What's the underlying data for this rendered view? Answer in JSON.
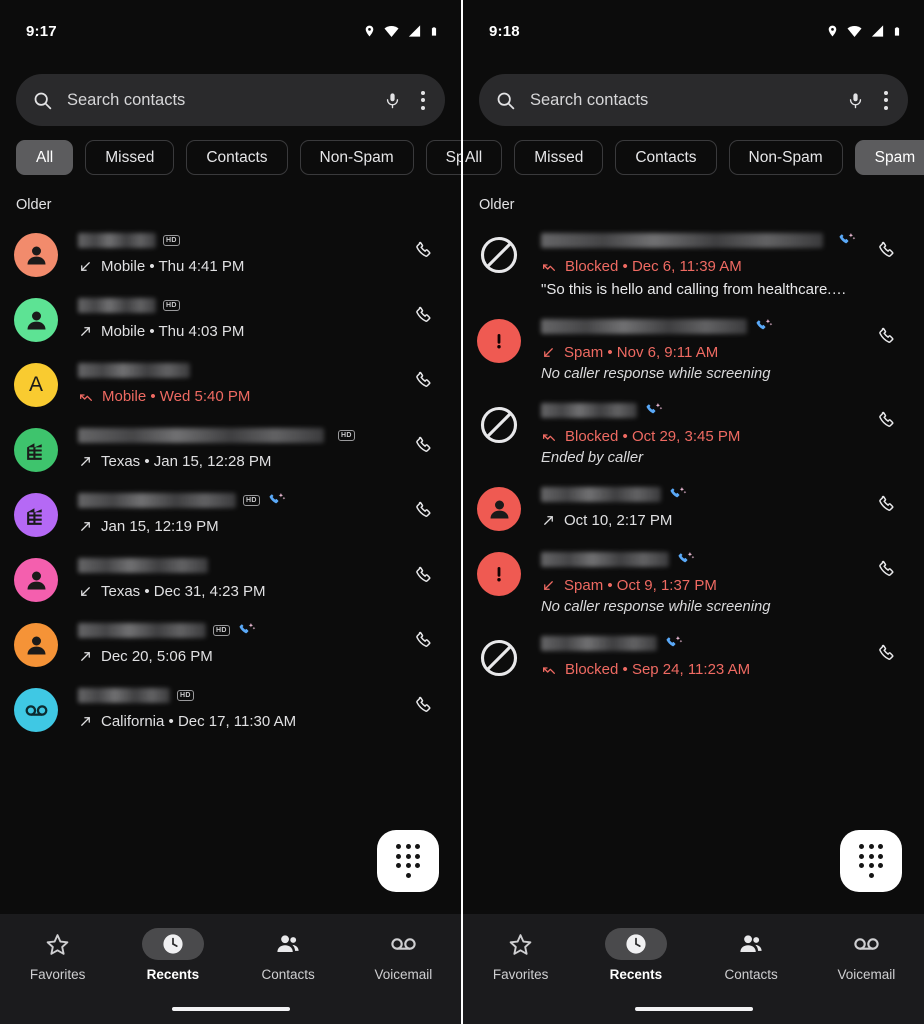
{
  "theme": {
    "background": "#0c0c0c",
    "nav_background": "#1b1b1d",
    "search_background": "#2a2a2c",
    "accent_red": "#ef6a62",
    "chip_selected": "#5c5c5e",
    "fab_background": "#ffffff",
    "divider": "#ffffff"
  },
  "panels": [
    {
      "id": "recents-all",
      "status_bar": {
        "time": "9:17",
        "icons": [
          "location-icon",
          "wifi-icon",
          "signal-icon",
          "battery-icon"
        ]
      },
      "search": {
        "placeholder": "Search contacts",
        "search_icon": "search-icon",
        "mic_icon": "microphone-icon",
        "overflow_icon": "more-vert-icon"
      },
      "chips": [
        {
          "label": "All",
          "selected": true
        },
        {
          "label": "Missed",
          "selected": false
        },
        {
          "label": "Contacts",
          "selected": false
        },
        {
          "label": "Non-Spam",
          "selected": false
        },
        {
          "label": "Spam",
          "selected": false
        }
      ],
      "chips_scrolled": false,
      "section_label": "Older",
      "calls": [
        {
          "avatar": {
            "type": "person",
            "color": "#f28b6c",
            "letter": ""
          },
          "name_redacted": true,
          "name_width": 78,
          "hd": true,
          "screened": false,
          "direction": "incoming",
          "detail": "Mobile • Thu 4:41 PM",
          "red": false,
          "note": "",
          "transcript": ""
        },
        {
          "avatar": {
            "type": "person",
            "color": "#5de394",
            "letter": ""
          },
          "name_redacted": true,
          "name_width": 78,
          "hd": true,
          "screened": false,
          "direction": "outgoing",
          "detail": "Mobile • Thu 4:03 PM",
          "red": false,
          "note": "",
          "transcript": ""
        },
        {
          "avatar": {
            "type": "letter",
            "color": "#f9cb30",
            "letter": "A"
          },
          "name_redacted": true,
          "name_width": 112,
          "hd": false,
          "screened": false,
          "direction": "missed",
          "detail": "Mobile • Wed 5:40 PM",
          "red": true,
          "note": "",
          "transcript": ""
        },
        {
          "avatar": {
            "type": "business",
            "color": "#3ec46d",
            "letter": ""
          },
          "name_redacted": true,
          "name_width": 246,
          "hd": true,
          "screened": false,
          "direction": "outgoing",
          "detail": "Texas • Jan 15, 12:28 PM",
          "red": false,
          "note": "",
          "transcript": ""
        },
        {
          "avatar": {
            "type": "business",
            "color": "#b569f5",
            "letter": ""
          },
          "name_redacted": true,
          "name_width": 158,
          "hd": true,
          "screened": true,
          "direction": "outgoing",
          "detail": "Jan 15, 12:19 PM",
          "red": false,
          "note": "",
          "transcript": ""
        },
        {
          "avatar": {
            "type": "person",
            "color": "#f45fae",
            "letter": ""
          },
          "name_redacted": true,
          "name_width": 130,
          "hd": false,
          "screened": false,
          "direction": "incoming",
          "detail": "Texas • Dec 31, 4:23 PM",
          "red": false,
          "note": "",
          "transcript": ""
        },
        {
          "avatar": {
            "type": "person",
            "color": "#f59337",
            "letter": ""
          },
          "name_redacted": true,
          "name_width": 128,
          "hd": true,
          "screened": true,
          "direction": "outgoing",
          "detail": "Dec 20, 5:06 PM",
          "red": false,
          "note": "",
          "transcript": ""
        },
        {
          "avatar": {
            "type": "voicemail",
            "color": "#3fc8e4",
            "letter": ""
          },
          "name_redacted": true,
          "name_width": 92,
          "hd": true,
          "screened": false,
          "direction": "outgoing",
          "detail": "California • Dec 17, 11:30 AM",
          "red": false,
          "note": "",
          "transcript": ""
        }
      ]
    },
    {
      "id": "recents-spam",
      "status_bar": {
        "time": "9:18",
        "icons": [
          "location-icon",
          "wifi-icon",
          "signal-icon",
          "battery-icon"
        ]
      },
      "search": {
        "placeholder": "Search contacts",
        "search_icon": "search-icon",
        "mic_icon": "microphone-icon",
        "overflow_icon": "more-vert-icon"
      },
      "chips": [
        {
          "label": "All",
          "selected": false
        },
        {
          "label": "Missed",
          "selected": false
        },
        {
          "label": "Contacts",
          "selected": false
        },
        {
          "label": "Non-Spam",
          "selected": false
        },
        {
          "label": "Spam",
          "selected": true
        }
      ],
      "chips_scrolled": true,
      "section_label": "Older",
      "calls": [
        {
          "avatar": {
            "type": "blocked",
            "color": "#e8e8ea",
            "letter": ""
          },
          "name_redacted": true,
          "name_width": 290,
          "hd": false,
          "screened": true,
          "direction": "missed",
          "detail": "Blocked • Dec 6, 11:39 AM",
          "red": true,
          "note": "",
          "transcript": "\"So this is hello and calling from healthcare.…"
        },
        {
          "avatar": {
            "type": "alert",
            "color": "#ef5a52",
            "letter": ""
          },
          "name_redacted": true,
          "name_width": 206,
          "hd": false,
          "screened": true,
          "direction": "incoming",
          "detail": "Spam • Nov 6, 9:11 AM",
          "red": true,
          "note": "No caller response while screening",
          "transcript": ""
        },
        {
          "avatar": {
            "type": "blocked",
            "color": "#e8e8ea",
            "letter": ""
          },
          "name_redacted": true,
          "name_width": 96,
          "hd": false,
          "screened": true,
          "direction": "missed",
          "detail": "Blocked • Oct 29, 3:45 PM",
          "red": true,
          "note": "Ended by caller",
          "transcript": ""
        },
        {
          "avatar": {
            "type": "person",
            "color": "#ef5a52",
            "letter": ""
          },
          "name_redacted": true,
          "name_width": 120,
          "hd": false,
          "screened": true,
          "direction": "outgoing",
          "detail": "Oct 10, 2:17 PM",
          "red": false,
          "note": "",
          "transcript": ""
        },
        {
          "avatar": {
            "type": "alert",
            "color": "#ef5a52",
            "letter": ""
          },
          "name_redacted": true,
          "name_width": 128,
          "hd": false,
          "screened": true,
          "direction": "incoming",
          "detail": "Spam • Oct 9, 1:37 PM",
          "red": true,
          "note": "No caller response while screening",
          "transcript": ""
        },
        {
          "avatar": {
            "type": "blocked",
            "color": "#e8e8ea",
            "letter": ""
          },
          "name_redacted": true,
          "name_width": 116,
          "hd": false,
          "screened": true,
          "direction": "missed",
          "detail": "Blocked • Sep 24, 11:23 AM",
          "red": true,
          "note": "",
          "transcript": ""
        }
      ]
    }
  ],
  "fab": {
    "icon": "dialpad-icon",
    "label": "Open dialpad"
  },
  "bottom_nav": [
    {
      "label": "Favorites",
      "icon": "star-icon",
      "active": false
    },
    {
      "label": "Recents",
      "icon": "clock-icon",
      "active": true
    },
    {
      "label": "Contacts",
      "icon": "people-icon",
      "active": false
    },
    {
      "label": "Voicemail",
      "icon": "voicemail-icon",
      "active": false
    }
  ]
}
